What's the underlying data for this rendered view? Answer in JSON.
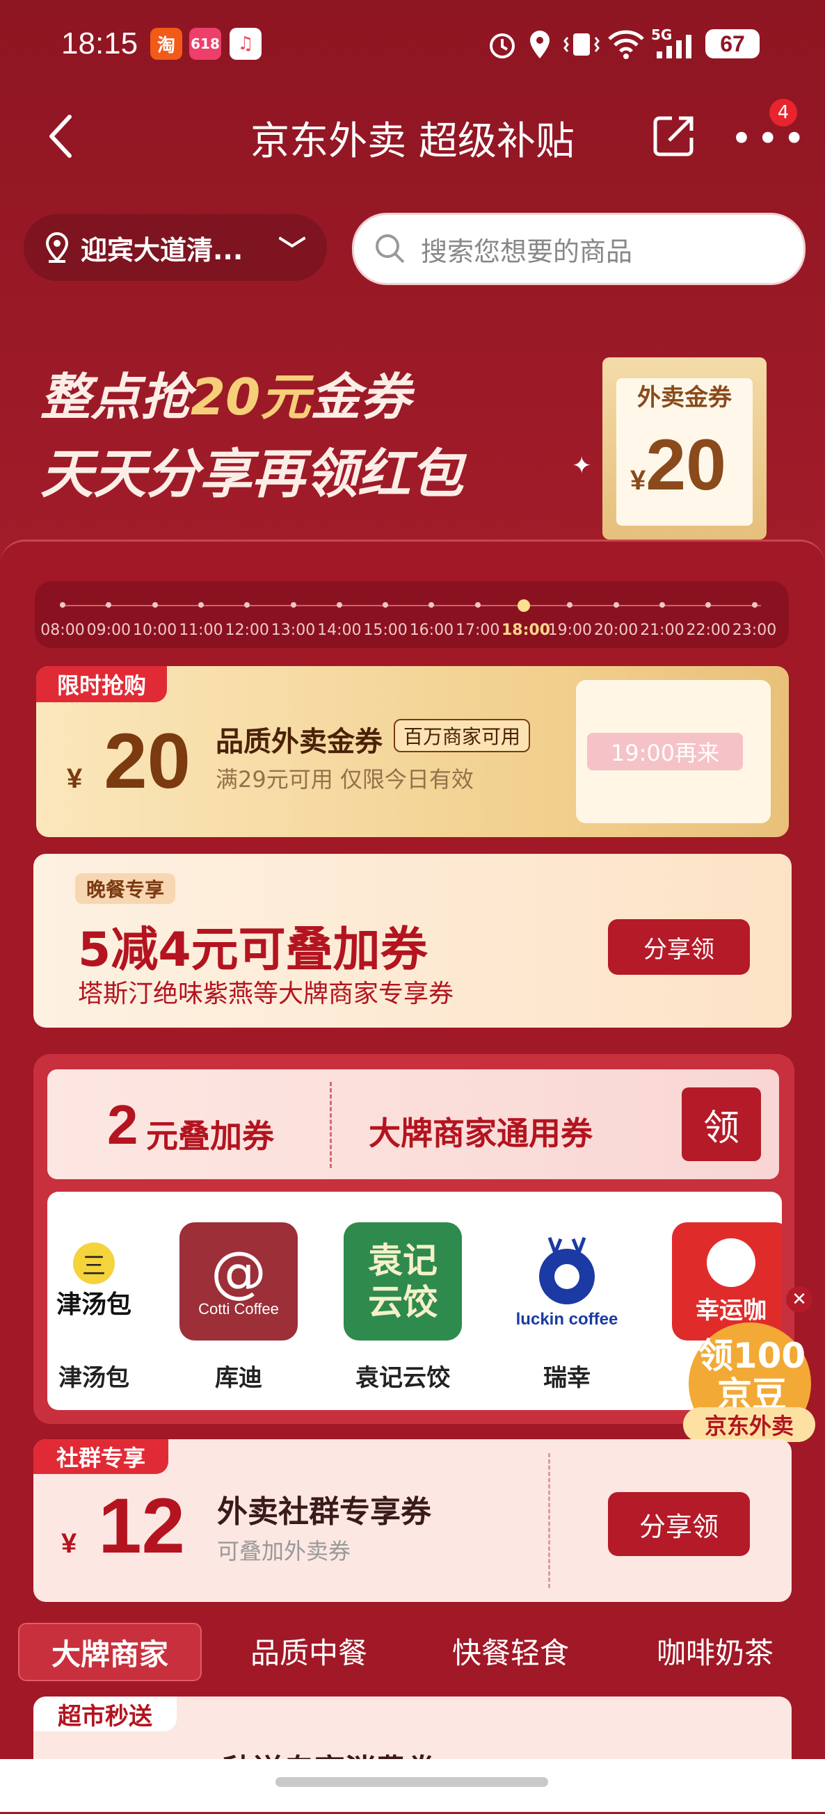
{
  "status_bar": {
    "time": "18:15",
    "app_icons": [
      "淘",
      "618",
      "♫"
    ],
    "battery": "67",
    "network": "5G"
  },
  "nav": {
    "title": "京东外卖 超级补贴",
    "badge": "4"
  },
  "location": {
    "text": "迎宾大道清..."
  },
  "search": {
    "placeholder": "搜索您想要的商品"
  },
  "banner": {
    "line1_a": "整点抢",
    "line1_b": "20元",
    "line1_c": "金券",
    "line2": "天天分享再领红包",
    "ticket_label": "外卖金券",
    "ticket_currency": "¥",
    "ticket_amount": "20"
  },
  "timeline": {
    "ticks": [
      "08:00",
      "09:00",
      "10:00",
      "11:00",
      "12:00",
      "13:00",
      "14:00",
      "15:00",
      "16:00",
      "17:00",
      "18:00",
      "19:00",
      "20:00",
      "21:00",
      "22:00",
      "23:00"
    ],
    "active_index": 10
  },
  "coupon_flash": {
    "tag": "限时抢购",
    "currency": "¥",
    "amount": "20",
    "title": "品质外卖金券",
    "pill": "百万商家可用",
    "subtitle": "满29元可用 仅限今日有效",
    "button": "19:00再来"
  },
  "coupon_dinner": {
    "tag": "晚餐专享",
    "title": "5减4元可叠加券",
    "subtitle": "塔斯汀绝味紫燕等大牌商家专享券",
    "button": "分享领"
  },
  "coupon_stack": {
    "amount": "2",
    "unit": "元叠加券",
    "title": "大牌商家通用券",
    "button": "领"
  },
  "brands": [
    {
      "name": "津汤包",
      "logo_text": "津汤包"
    },
    {
      "name": "库迪",
      "logo_text": "Cotti Coffee"
    },
    {
      "name": "袁记云饺",
      "logo_text": "袁记云饺"
    },
    {
      "name": "瑞幸",
      "logo_text": "luckin coffee"
    },
    {
      "name": "幸运咖",
      "logo_text": "幸运咖"
    }
  ],
  "floating": {
    "line1": "领100",
    "line2": "京豆",
    "label": "京东外卖"
  },
  "coupon_group": {
    "tag": "社群专享",
    "currency": "¥",
    "amount": "12",
    "title": "外卖社群专享券",
    "subtitle": "可叠加外卖券",
    "button": "分享领"
  },
  "tabs": [
    "大牌商家",
    "品质中餐",
    "快餐轻食",
    "咖啡奶茶"
  ],
  "coupon_partial": {
    "tag": "超市秒送",
    "title": "秒送专享消费券"
  },
  "colors": {
    "primary_red": "#b51a28",
    "gold": "#f6cf79"
  }
}
